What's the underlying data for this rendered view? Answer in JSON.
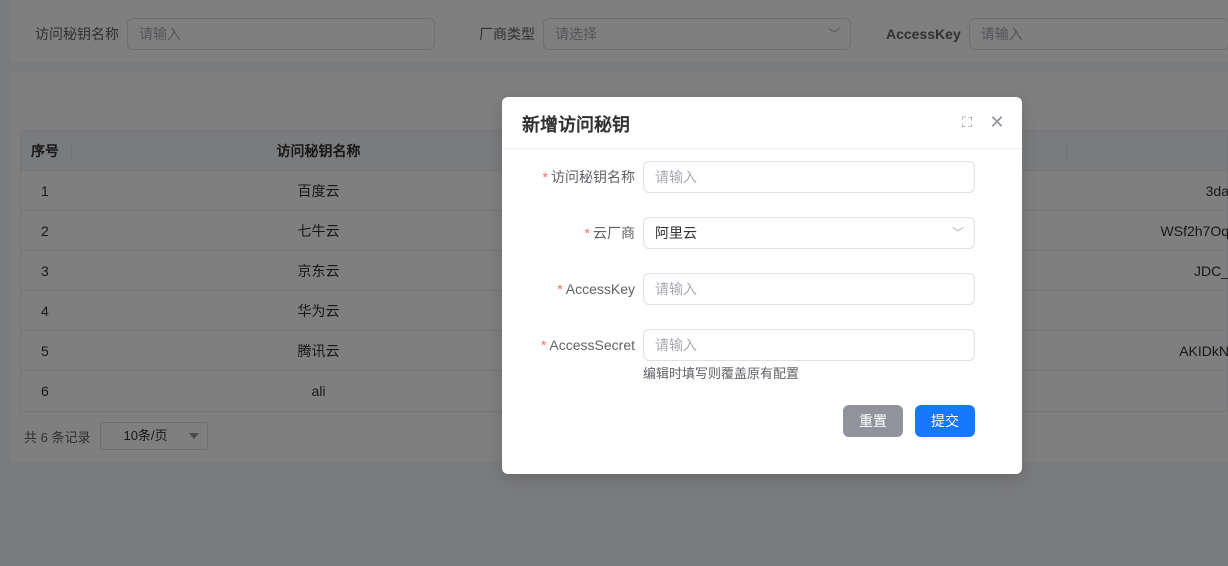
{
  "filters": {
    "name_label": "访问秘钥名称",
    "name_placeholder": "请输入",
    "vendor_label": "厂商类型",
    "vendor_placeholder": "请选择",
    "accesskey_label": "AccessKey",
    "accesskey_placeholder": "请输入"
  },
  "table": {
    "headers": {
      "no": "序号",
      "name": "访问秘钥名称"
    },
    "rows": [
      {
        "no": "1",
        "name": "百度云",
        "key": "3da"
      },
      {
        "no": "2",
        "name": "七牛云",
        "key": "WSf2h7Oq"
      },
      {
        "no": "3",
        "name": "京东云",
        "key": "JDC_"
      },
      {
        "no": "4",
        "name": "华为云",
        "key": ""
      },
      {
        "no": "5",
        "name": "腾讯云",
        "key": "AKIDkN"
      },
      {
        "no": "6",
        "name": "ali",
        "key": ""
      }
    ]
  },
  "pager": {
    "total_text": "共 6 条记录",
    "page_size": "10条/页"
  },
  "dialog": {
    "title": "新增访问秘钥",
    "fields": {
      "name_label": "访问秘钥名称",
      "name_placeholder": "请输入",
      "vendor_label": "云厂商",
      "vendor_value": "阿里云",
      "accesskey_label": "AccessKey",
      "accesskey_placeholder": "请输入",
      "secret_label": "AccessSecret",
      "secret_placeholder": "请输入",
      "secret_hint": "编辑时填写则覆盖原有配置"
    },
    "required_mark": "*",
    "reset_label": "重置",
    "submit_label": "提交",
    "fullscreen_icon": "⛶",
    "close_icon": "✕"
  },
  "icons": {
    "chevron": "﹀"
  },
  "colors": {
    "primary": "#1677ff",
    "reset_button": "#909399",
    "required": "#f56c6c"
  }
}
